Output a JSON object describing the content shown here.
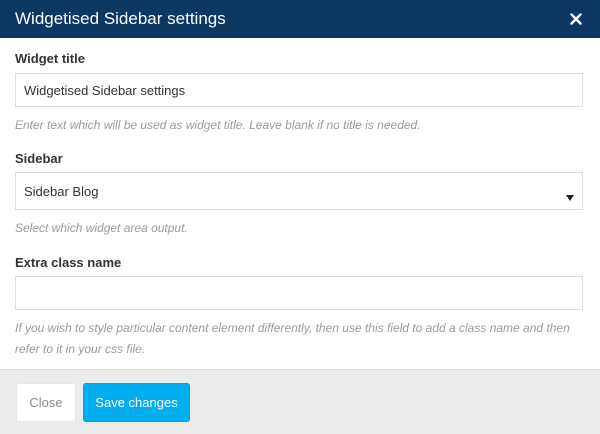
{
  "dialog": {
    "title": "Widgetised Sidebar settings",
    "close_icon": "close-icon"
  },
  "fields": {
    "widget_title": {
      "label": "Widget title",
      "value": "Widgetised Sidebar settings",
      "help": "Enter text which will be used as widget title. Leave blank if no title is needed."
    },
    "sidebar": {
      "label": "Sidebar",
      "selected": "Sidebar Blog",
      "help": "Select which widget area output.",
      "arrow_icon": "caret-down-icon"
    },
    "extra_class": {
      "label": "Extra class name",
      "value": "",
      "help": "If you wish to style particular content element differently, then use this field to add a class name and then refer to it in your css file."
    }
  },
  "footer": {
    "close_label": "Close",
    "save_label": "Save changes"
  },
  "colors": {
    "header_bg": "#0a3863",
    "primary_button": "#00aeef",
    "footer_bg": "#ececec"
  }
}
